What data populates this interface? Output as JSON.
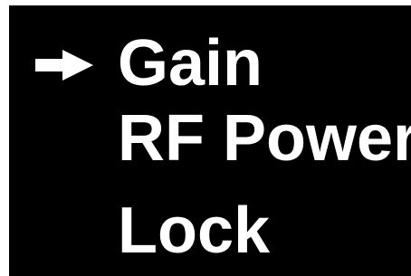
{
  "menu": {
    "selected_index": 0,
    "items": [
      {
        "label": "Gain"
      },
      {
        "label": "RF Power"
      },
      {
        "label": "Lock"
      }
    ],
    "pointer_icon": "right-arrow-icon"
  },
  "colors": {
    "background": "#000000",
    "text": "#ffffff",
    "frame": "#ffffff"
  }
}
